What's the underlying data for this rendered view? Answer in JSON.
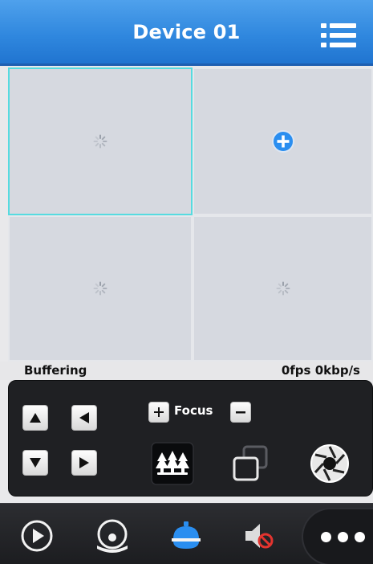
{
  "header": {
    "title": "Device 01",
    "menu_icon": "list-menu-icon"
  },
  "grid": {
    "selected_cell": 1,
    "cells": [
      {
        "state": "loading",
        "icon": "spinner-icon"
      },
      {
        "state": "empty",
        "icon": "add-channel-icon"
      },
      {
        "state": "loading",
        "icon": "spinner-icon"
      },
      {
        "state": "loading",
        "icon": "spinner-icon"
      }
    ]
  },
  "status": {
    "text": "Buffering",
    "rate": "0fps  0kbp/s"
  },
  "ptz": {
    "directions": [
      "up-arrow-icon",
      "left-arrow-icon",
      "down-arrow-icon",
      "right-arrow-icon"
    ],
    "focus_label": "Focus",
    "focus_in_icon": "plus-icon",
    "focus_out_icon": "minus-icon",
    "tools": [
      "scene-icon",
      "window-icon",
      "iris-icon"
    ]
  },
  "bottom_nav": {
    "items": [
      "play-icon",
      "ptz-camera-icon",
      "alarm-icon",
      "audio-muted-icon",
      "more-icon"
    ],
    "active": "alarm-icon"
  },
  "colors": {
    "header": "#2f87de",
    "selection": "#56dbe0",
    "active_nav": "#2a8ef0",
    "mute": "#e3342f"
  }
}
